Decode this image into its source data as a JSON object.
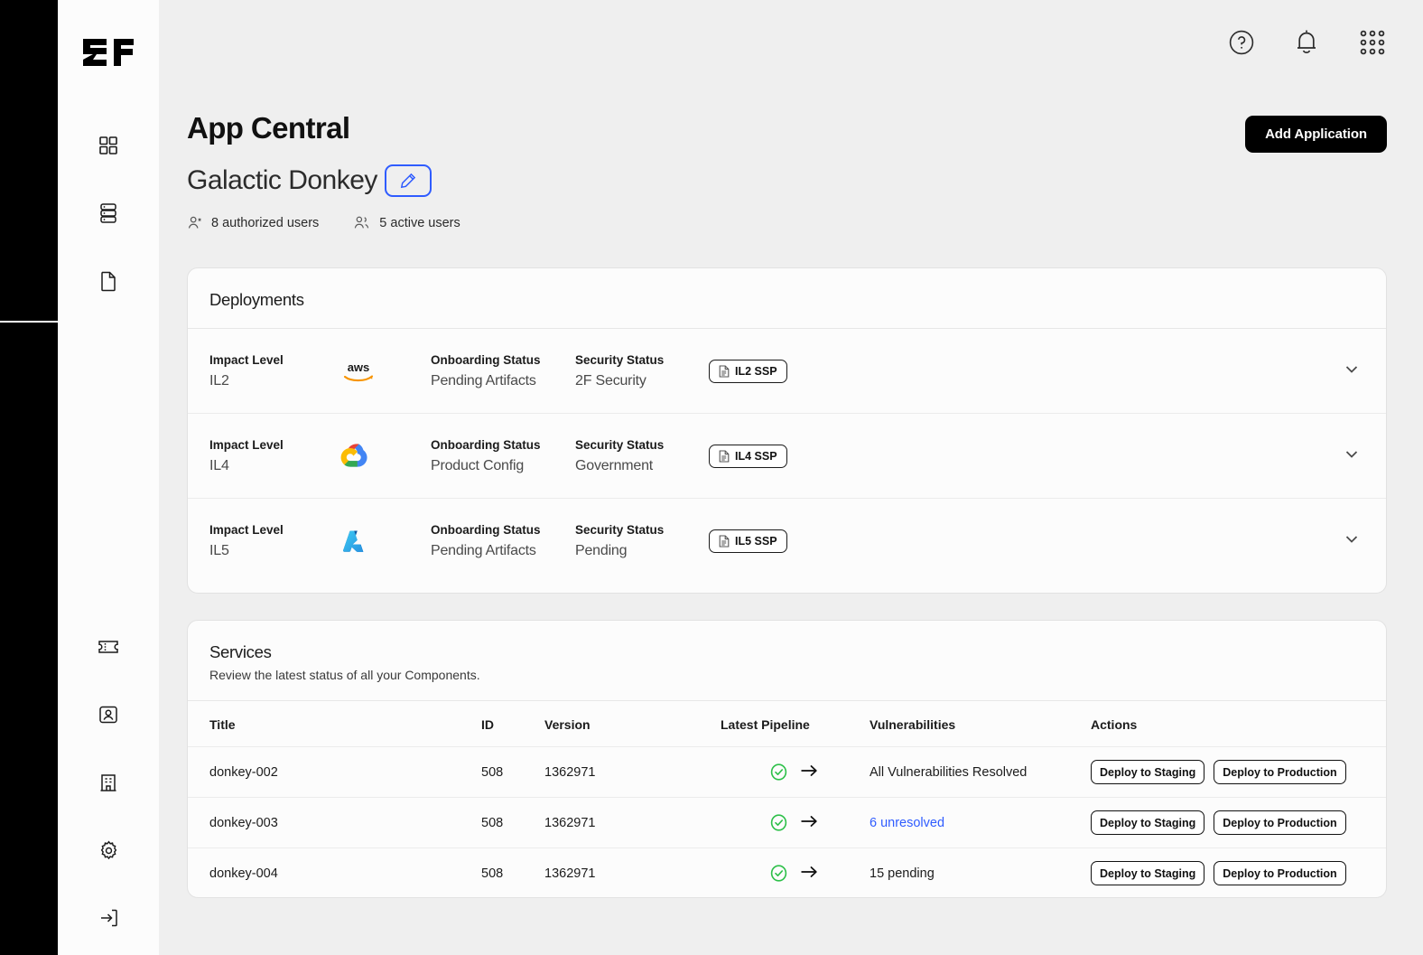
{
  "brand": {
    "logo_text": "2F"
  },
  "sidebar": {
    "top_items": [
      {
        "name": "dashboard",
        "icon": "grid-icon"
      },
      {
        "name": "database",
        "icon": "database-icon"
      },
      {
        "name": "documents",
        "icon": "document-icon"
      }
    ],
    "bottom_items": [
      {
        "name": "tickets",
        "icon": "ticket-icon"
      },
      {
        "name": "profile",
        "icon": "user-card-icon"
      },
      {
        "name": "organization",
        "icon": "building-icon"
      },
      {
        "name": "settings",
        "icon": "gear-icon"
      },
      {
        "name": "logout",
        "icon": "logout-icon"
      }
    ]
  },
  "topbar": {
    "help_icon": "help-circle-icon",
    "notifications_icon": "bell-icon",
    "apps_icon": "grid-dots-icon"
  },
  "header": {
    "title": "App Central",
    "app_name": "Galactic Donkey",
    "edit_icon": "pencil-icon",
    "authorized_users": "8 authorized users",
    "active_users": "5 active users",
    "add_application_label": "Add Application"
  },
  "deployments": {
    "title": "Deployments",
    "labels": {
      "impact_level": "Impact Level",
      "onboarding_status": "Onboarding Status",
      "security_status": "Security Status"
    },
    "rows": [
      {
        "impact_level": "IL2",
        "provider": "aws",
        "onboarding_status": "Pending Artifacts",
        "security_status": "2F Security",
        "ssp_label": "IL2 SSP"
      },
      {
        "impact_level": "IL4",
        "provider": "google-cloud",
        "onboarding_status": "Product Config",
        "security_status": "Government",
        "ssp_label": "IL4 SSP"
      },
      {
        "impact_level": "IL5",
        "provider": "azure",
        "onboarding_status": "Pending Artifacts",
        "security_status": "Pending",
        "ssp_label": "IL5 SSP"
      }
    ]
  },
  "services": {
    "title": "Services",
    "subtitle": "Review the latest status of all your Components.",
    "columns": [
      "Title",
      "ID",
      "Version",
      "Latest Pipeline",
      "Vulnerabilities",
      "Actions"
    ],
    "rows": [
      {
        "title": "donkey-002",
        "id": "508",
        "version": "1362971",
        "pipeline_status": "success",
        "vulnerabilities": "All Vulnerabilities Resolved",
        "vulnerabilities_is_link": false,
        "deploy_staging": "Deploy to Staging",
        "deploy_production": "Deploy to Production"
      },
      {
        "title": "donkey-003",
        "id": "508",
        "version": "1362971",
        "pipeline_status": "success",
        "vulnerabilities": "6 unresolved",
        "vulnerabilities_is_link": true,
        "deploy_staging": "Deploy to Staging",
        "deploy_production": "Deploy to Production"
      },
      {
        "title": "donkey-004",
        "id": "508",
        "version": "1362971",
        "pipeline_status": "success",
        "vulnerabilities": "15 pending",
        "vulnerabilities_is_link": false,
        "deploy_staging": "Deploy to Staging",
        "deploy_production": "Deploy to Production"
      }
    ]
  },
  "colors": {
    "accent_blue": "#2f5cff",
    "success_green": "#2ec04a",
    "page_bg": "#efefef",
    "card_bg": "#fcfcfc",
    "rail_black": "#000000"
  }
}
